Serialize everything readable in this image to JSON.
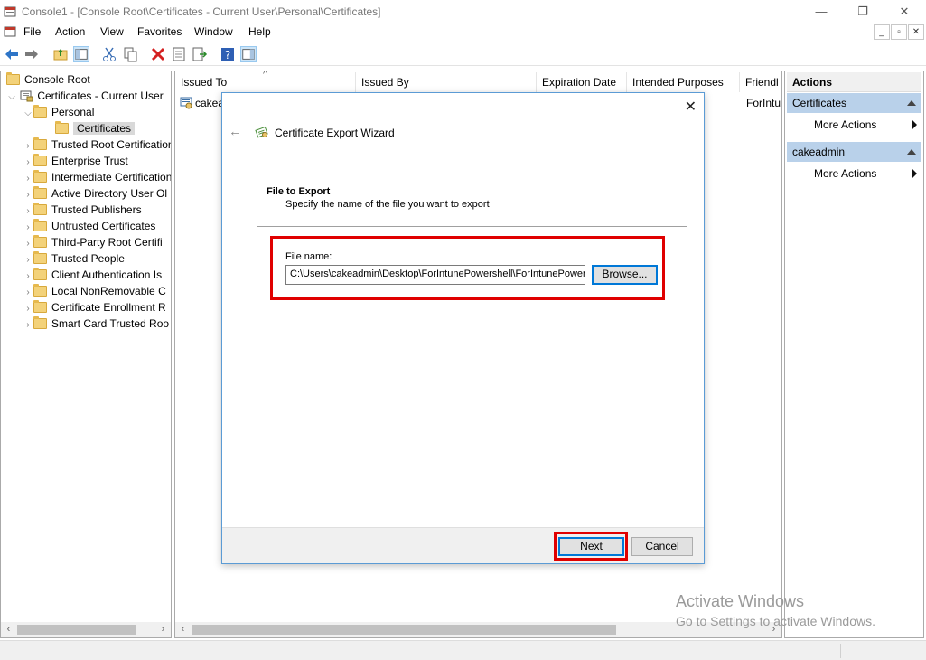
{
  "window": {
    "title": "Console1 - [Console Root\\Certificates - Current User\\Personal\\Certificates]",
    "minimize": "—",
    "restore": "❐",
    "close": "✕"
  },
  "menu": {
    "items": [
      "File",
      "Action",
      "View",
      "Favorites",
      "Window",
      "Help"
    ],
    "mdi_buttons": [
      "_",
      "▫",
      "✕"
    ]
  },
  "tree": {
    "items": [
      {
        "label": "Console Root"
      },
      {
        "label": "Certificates - Current User"
      },
      {
        "label": "Personal"
      },
      {
        "label": "Certificates"
      },
      {
        "label": "Trusted Root Certification"
      },
      {
        "label": "Enterprise Trust"
      },
      {
        "label": "Intermediate Certification"
      },
      {
        "label": "Active Directory User Ol"
      },
      {
        "label": "Trusted Publishers"
      },
      {
        "label": "Untrusted Certificates"
      },
      {
        "label": "Third-Party Root Certifi"
      },
      {
        "label": "Trusted People"
      },
      {
        "label": "Client Authentication Is"
      },
      {
        "label": "Local NonRemovable C"
      },
      {
        "label": "Certificate Enrollment R"
      },
      {
        "label": "Smart Card Trusted Roo"
      }
    ]
  },
  "list": {
    "columns": [
      "Issued To",
      "Issued By",
      "Expiration Date",
      "Intended Purposes",
      "Friendl"
    ],
    "sort_glyph": "^",
    "rows": [
      {
        "issued_to": "cakea",
        "friendly": "ForIntu"
      }
    ]
  },
  "actions": {
    "header": "Actions",
    "sections": [
      {
        "title": "Certificates",
        "item": "More Actions"
      },
      {
        "title": "cakeadmin",
        "item": "More Actions"
      }
    ]
  },
  "dialog": {
    "close": "✕",
    "back": "←",
    "title": "Certificate Export Wizard",
    "section_heading": "File to Export",
    "section_desc": "Specify the name of the file you want to export",
    "file_label": "File name:",
    "file_value": "C:\\Users\\cakeadmin\\Desktop\\ForIntunePowershell\\ForIntunePowershell",
    "browse": "Browse...",
    "next": "Next",
    "cancel": "Cancel"
  },
  "watermark": {
    "line1": "Activate Windows",
    "line2": "Go to Settings to activate Windows."
  },
  "colors": {
    "highlight": "#e00000",
    "actions_section": "#b9d1ea",
    "dialog_border": "#5b9bd5"
  }
}
